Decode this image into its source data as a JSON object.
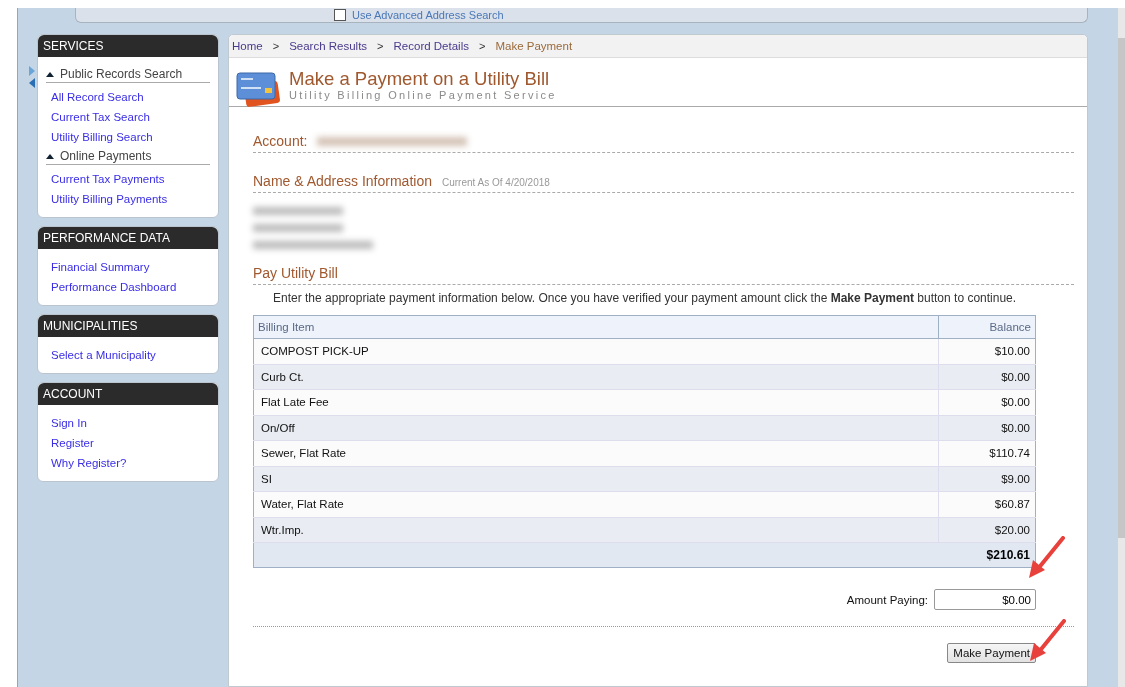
{
  "top_panel": {
    "advanced_search": {
      "label": "Use Advanced Address Search",
      "checked": false
    }
  },
  "sidebar": [
    {
      "title": "SERVICES",
      "groups": [
        {
          "heading": "Public Records Search",
          "links": [
            "All Record Search",
            "Current Tax Search",
            "Utility Billing Search"
          ]
        },
        {
          "heading": "Online Payments",
          "links": [
            "Current Tax Payments",
            "Utility Billing Payments"
          ]
        }
      ]
    },
    {
      "title": "PERFORMANCE DATA",
      "groups": [
        {
          "links": [
            "Financial Summary",
            "Performance Dashboard"
          ]
        }
      ]
    },
    {
      "title": "MUNICIPALITIES",
      "groups": [
        {
          "links": [
            "Select a Municipality"
          ]
        }
      ]
    },
    {
      "title": "ACCOUNT",
      "groups": [
        {
          "links": [
            "Sign In",
            "Register",
            "Why Register?"
          ]
        }
      ]
    }
  ],
  "breadcrumb": [
    {
      "label": "Home",
      "current": false
    },
    {
      "label": "Search Results",
      "current": false
    },
    {
      "label": "Record Details",
      "current": false
    },
    {
      "label": "Make Payment",
      "current": true
    }
  ],
  "breadcrumb_separator": ">",
  "header": {
    "title": "Make a Payment on a Utility Bill",
    "subtitle": "Utility Billing Online Payment Service"
  },
  "account": {
    "label": "Account:"
  },
  "name_address": {
    "title": "Name & Address Information",
    "note": "Current As Of 4/20/2018"
  },
  "pay": {
    "title": "Pay Utility Bill",
    "instruction": "Enter the appropriate payment information below. Once you have verified your payment amount click the **Make Payment** button to continue."
  },
  "table": {
    "columns": [
      "Billing Item",
      "Balance"
    ],
    "rows": [
      [
        "COMPOST PICK-UP",
        "$10.00"
      ],
      [
        "Curb Ct.",
        "$0.00"
      ],
      [
        "Flat Late Fee",
        "$0.00"
      ],
      [
        "On/Off",
        "$0.00"
      ],
      [
        "Sewer, Flat Rate",
        "$110.74"
      ],
      [
        "SI",
        "$9.00"
      ],
      [
        "Water, Flat Rate",
        "$60.87"
      ],
      [
        "Wtr.Imp.",
        "$20.00"
      ]
    ],
    "total": "$210.61"
  },
  "amount_paying": {
    "label": "Amount Paying:",
    "value": "$0.00"
  },
  "submit_button": "Make Payment"
}
